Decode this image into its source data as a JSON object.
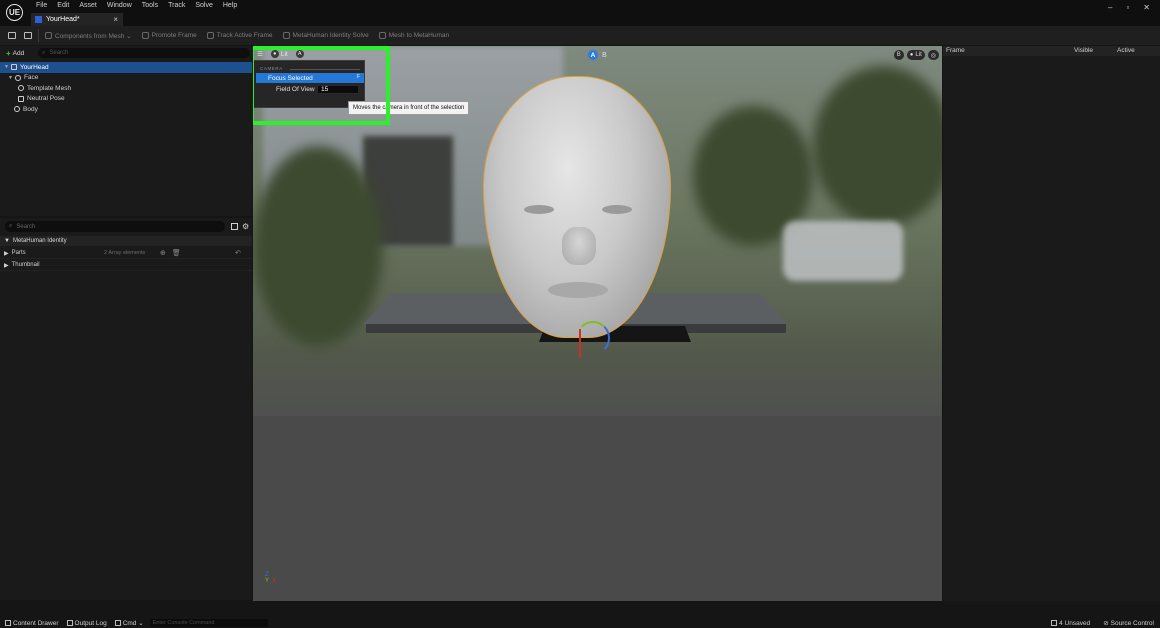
{
  "app": {
    "logo": "UE",
    "menu": [
      "File",
      "Edit",
      "Asset",
      "Window",
      "Tools",
      "Track",
      "Solve",
      "Help"
    ],
    "document_tab": "YourHead*",
    "window_controls": [
      "–",
      "▫",
      "✕"
    ]
  },
  "toolbar": {
    "components_from_mesh": "Components from Mesh ⌄",
    "promote_frame": "Promote Frame",
    "track_active_frame": "Track Active Frame",
    "identity_solve": "MetaHuman Identity Solve",
    "mesh_to_metahuman": "Mesh to MetaHuman"
  },
  "outliner": {
    "add_label": "Add",
    "search_placeholder": "Search",
    "items": [
      {
        "label": "YourHead",
        "indent": 0
      },
      {
        "label": "Face",
        "indent": 1
      },
      {
        "label": "Template Mesh",
        "indent": 2
      },
      {
        "label": "Neutral Pose",
        "indent": 2
      },
      {
        "label": "Body",
        "indent": 1
      }
    ]
  },
  "details": {
    "search_placeholder": "Search",
    "section": "MetaHuman Identity",
    "parts_label": "Parts",
    "parts_value": "2 Array elements",
    "thumbnail_label": "Thumbnail"
  },
  "viewport": {
    "lit_label": "Lit",
    "a_label": "A",
    "b_label": "B",
    "right_lit_label": "Lit",
    "right_b_label": "B",
    "camera_menu": {
      "section_header": "CAMERA",
      "focus_selected": "Focus Selected",
      "focus_shortcut": "F",
      "fov_label": "Field Of View",
      "fov_value": "15"
    },
    "tooltip": "Moves the camera in front of the selection",
    "axis_z": "Z",
    "axis_x": "X",
    "axis_y": "Y",
    "highlight_color": "#2af12a",
    "selection_outline_color": "#e2a23a"
  },
  "frames_panel": {
    "columns": [
      "Frame",
      "Visible",
      "Active"
    ]
  },
  "statusbar": {
    "content_drawer": "Content Drawer",
    "output_log": "Output Log",
    "cmd": "Cmd ⌄",
    "console_placeholder": "Enter Console Command",
    "unsaved": "4 Unsaved",
    "source_control": "Source Control"
  }
}
